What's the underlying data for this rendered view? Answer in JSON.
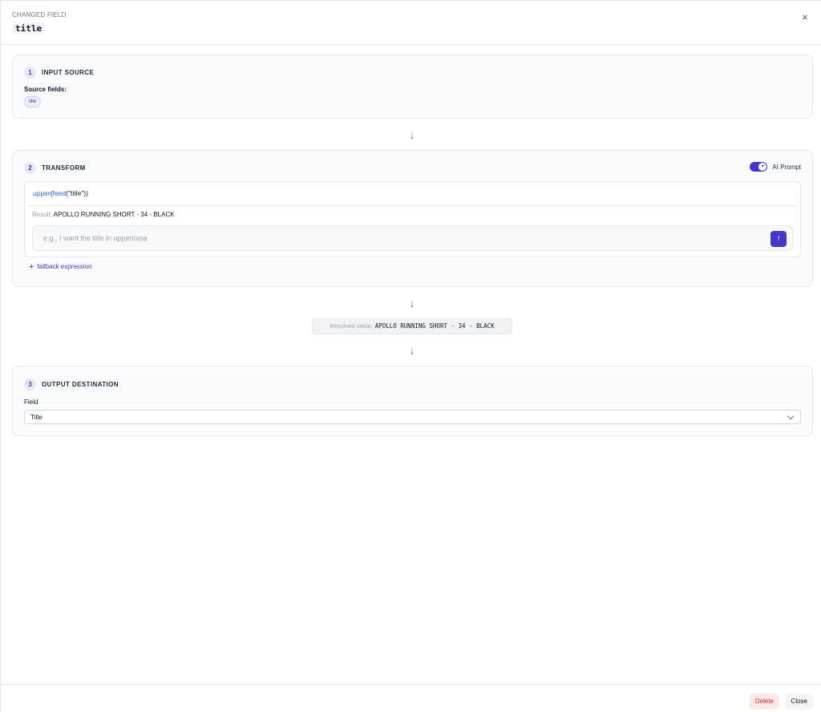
{
  "header": {
    "label": "CHANGED FIELD",
    "field_name": "title",
    "close_icon": "×"
  },
  "input_source": {
    "step": "1",
    "title": "INPUT SOURCE",
    "source_label": "Source fields:",
    "chips": [
      "title"
    ]
  },
  "arrow": "↓",
  "transform": {
    "step": "2",
    "title": "TRANSFORM",
    "ai_prompt_label": "AI Prompt",
    "ai_prompt_enabled": true,
    "expression": {
      "fn1": "upper",
      "p1": "(",
      "fn2": "feed",
      "p2": "(\"title\"))"
    },
    "result_key": "Result:",
    "result_value": "APOLLO RUNNING SHORT - 34 - BLACK",
    "prompt_placeholder": "e.g., I want the title in uppercase",
    "send_icon": "↑",
    "fallback_icon": "+",
    "fallback_label": "fallback expression"
  },
  "resolved": {
    "label": "Resolved value:",
    "value": "APOLLO RUNNING SHORT - 34 - BLACK"
  },
  "output": {
    "step": "3",
    "title": "OUTPUT DESTINATION",
    "field_label": "Field",
    "field_value": "Title"
  },
  "footer": {
    "delete_label": "Delete",
    "close_label": "Close"
  },
  "colors": {
    "accent": "#4338ca",
    "danger": "#dc2626",
    "link": "#2563eb"
  }
}
